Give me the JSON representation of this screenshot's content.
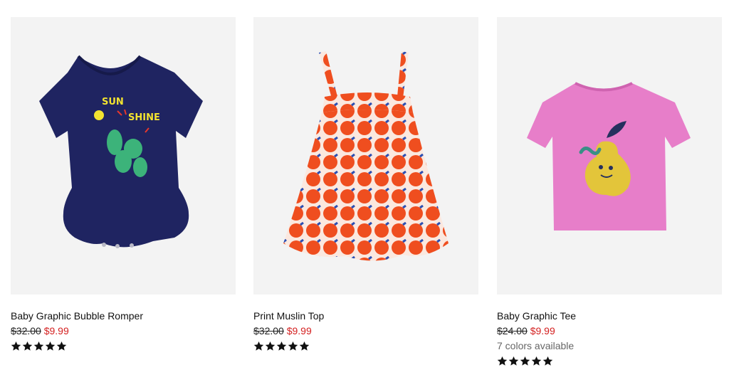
{
  "products": [
    {
      "name": "Baby Graphic Bubble Romper",
      "old_price": "$32.00",
      "sale_price": "$9.99",
      "rating": 5,
      "image_text_top": "SUN",
      "image_text_bottom": "SHINE",
      "colors": {
        "garment": "#1f2461",
        "cactus": "#3cb37a",
        "sun": "#f2e330",
        "accent": "#e8372b"
      }
    },
    {
      "name": "Print Muslin Top",
      "old_price": "$32.00",
      "sale_price": "$9.99",
      "rating": 5,
      "colors": {
        "base": "#fbe8df",
        "dot": "#ef4e1f",
        "leaf": "#2b4fb3"
      }
    },
    {
      "name": "Baby Graphic Tee",
      "old_price": "$24.00",
      "sale_price": "$9.99",
      "colors_available": "7 colors available",
      "rating": 5,
      "colors": {
        "garment": "#e77ec9",
        "pear": "#e3c53a",
        "leaf": "#25305e",
        "worm": "#3a8f86"
      }
    }
  ],
  "theme": {
    "sale_color": "#d42020",
    "star_color": "#111111"
  }
}
